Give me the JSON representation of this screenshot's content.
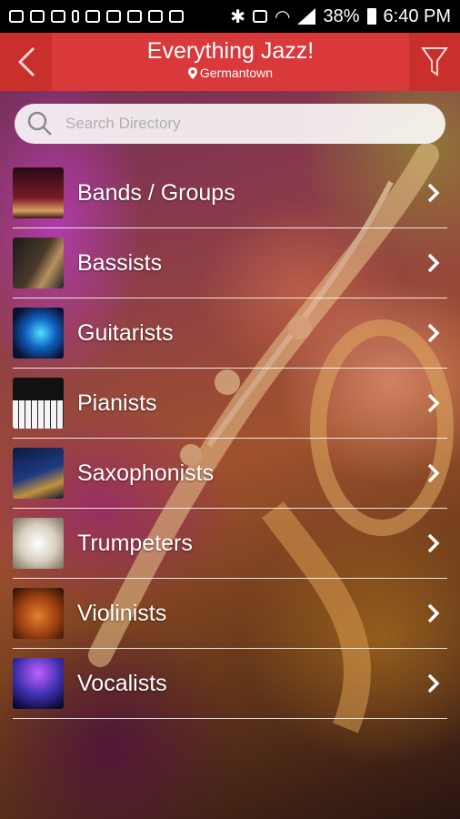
{
  "status_bar": {
    "battery_percent": "38%",
    "time": "6:40 PM"
  },
  "header": {
    "title": "Everything Jazz!",
    "location": "Germantown"
  },
  "search": {
    "placeholder": "Search Directory"
  },
  "categories": [
    {
      "label": "Bands / Groups",
      "thumb_icon": "band-stage-photo"
    },
    {
      "label": "Bassists",
      "thumb_icon": "bass-guitar-photo"
    },
    {
      "label": "Guitarists",
      "thumb_icon": "electric-guitar-photo"
    },
    {
      "label": "Pianists",
      "thumb_icon": "piano-keys-photo"
    },
    {
      "label": "Saxophonists",
      "thumb_icon": "saxophone-photo"
    },
    {
      "label": "Trumpeters",
      "thumb_icon": "trumpet-photo"
    },
    {
      "label": "Violinists",
      "thumb_icon": "violin-photo"
    },
    {
      "label": "Vocalists",
      "thumb_icon": "microphone-photo"
    }
  ],
  "colors": {
    "header_red": "#d9393a",
    "header_dark_red": "#c9302c",
    "divider": "#ffffff"
  }
}
